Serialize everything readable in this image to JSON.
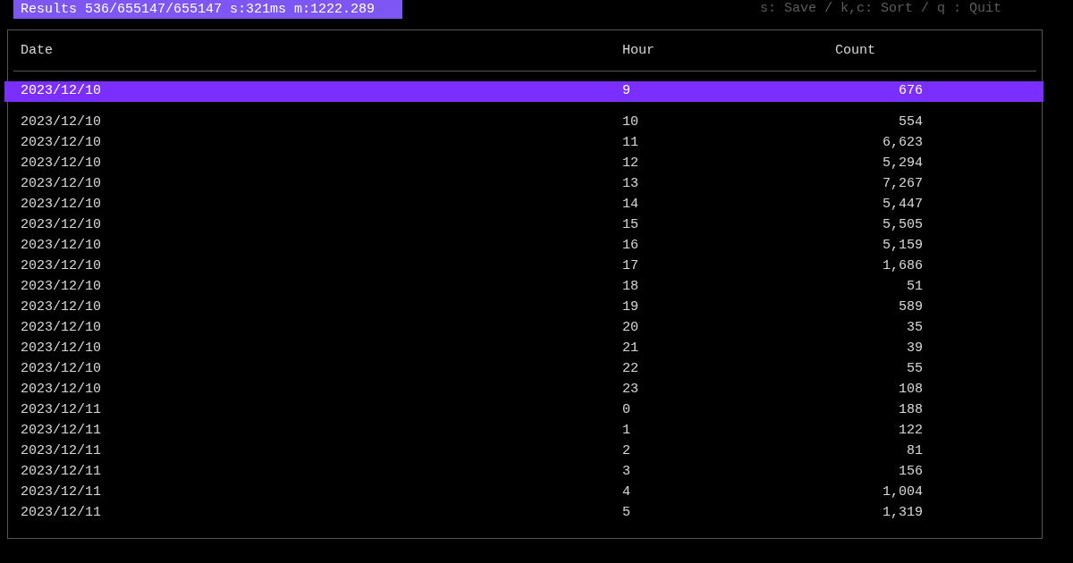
{
  "status_bar": {
    "results": "Results 536/655147/655147 s:321ms m:1222.289",
    "help": "s: Save / k,c: Sort / q : Quit"
  },
  "table": {
    "columns": [
      "Date",
      "Hour",
      "Count"
    ],
    "rows": [
      {
        "cells": [
          "2023/12/10",
          "9",
          "676"
        ],
        "selected": true
      },
      {
        "cells": [
          "2023/12/10",
          "10",
          "554"
        ],
        "selected": false
      },
      {
        "cells": [
          "2023/12/10",
          "11",
          "6,623"
        ],
        "selected": false
      },
      {
        "cells": [
          "2023/12/10",
          "12",
          "5,294"
        ],
        "selected": false
      },
      {
        "cells": [
          "2023/12/10",
          "13",
          "7,267"
        ],
        "selected": false
      },
      {
        "cells": [
          "2023/12/10",
          "14",
          "5,447"
        ],
        "selected": false
      },
      {
        "cells": [
          "2023/12/10",
          "15",
          "5,505"
        ],
        "selected": false
      },
      {
        "cells": [
          "2023/12/10",
          "16",
          "5,159"
        ],
        "selected": false
      },
      {
        "cells": [
          "2023/12/10",
          "17",
          "1,686"
        ],
        "selected": false
      },
      {
        "cells": [
          "2023/12/10",
          "18",
          "51"
        ],
        "selected": false
      },
      {
        "cells": [
          "2023/12/10",
          "19",
          "589"
        ],
        "selected": false
      },
      {
        "cells": [
          "2023/12/10",
          "20",
          "35"
        ],
        "selected": false
      },
      {
        "cells": [
          "2023/12/10",
          "21",
          "39"
        ],
        "selected": false
      },
      {
        "cells": [
          "2023/12/10",
          "22",
          "55"
        ],
        "selected": false
      },
      {
        "cells": [
          "2023/12/10",
          "23",
          "108"
        ],
        "selected": false
      },
      {
        "cells": [
          "2023/12/11",
          "0",
          "188"
        ],
        "selected": false
      },
      {
        "cells": [
          "2023/12/11",
          "1",
          "122"
        ],
        "selected": false
      },
      {
        "cells": [
          "2023/12/11",
          "2",
          "81"
        ],
        "selected": false
      },
      {
        "cells": [
          "2023/12/11",
          "3",
          "156"
        ],
        "selected": false
      },
      {
        "cells": [
          "2023/12/11",
          "4",
          "1,004"
        ],
        "selected": false
      },
      {
        "cells": [
          "2023/12/11",
          "5",
          "1,319"
        ],
        "selected": false
      }
    ]
  }
}
